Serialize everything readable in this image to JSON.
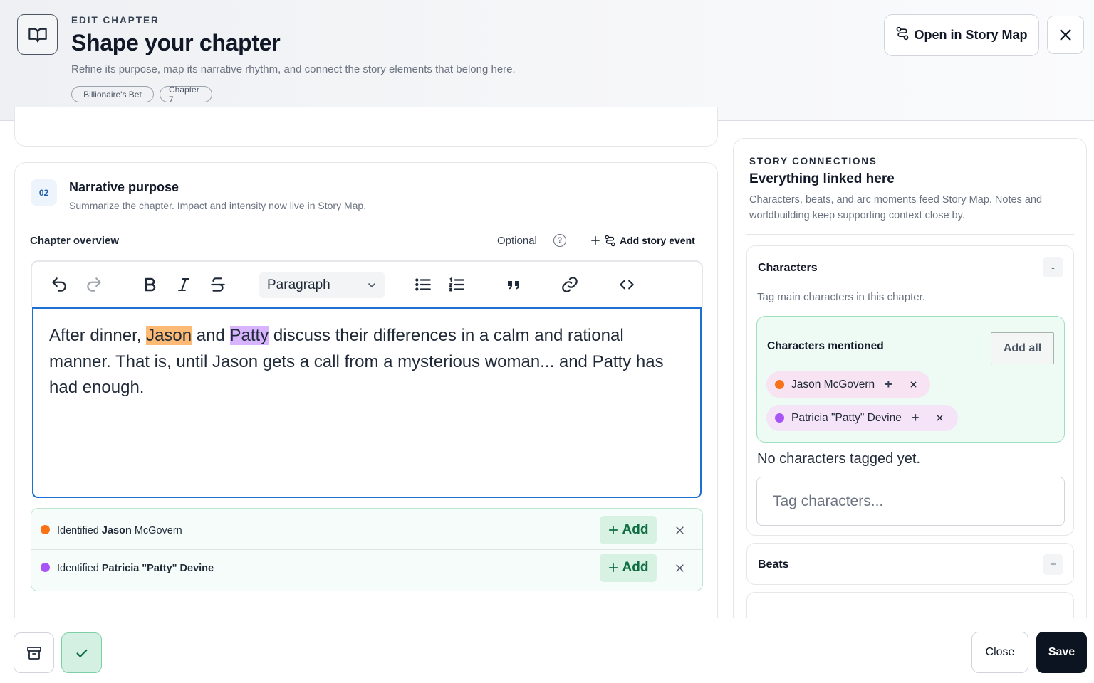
{
  "header": {
    "eyebrow": "EDIT CHAPTER",
    "title": "Shape your chapter",
    "subtitle": "Refine its purpose, map its narrative rhythm, and connect the story elements that belong here.",
    "chips": [
      "Billionaire's Bet",
      "Chapter 7"
    ],
    "open_map_label": "Open in Story Map",
    "icons": {
      "book": "book-open-icon",
      "map": "story-map-icon",
      "close": "close-icon"
    }
  },
  "section": {
    "step": "02",
    "title": "Narrative purpose",
    "description": "Summarize the chapter. Impact and intensity now live in Story Map.",
    "overview_label": "Chapter overview",
    "optional_label": "Optional",
    "help_glyph": "?",
    "add_event_label": "Add story event"
  },
  "toolbar": {
    "block_type": "Paragraph",
    "buttons": [
      "undo-icon",
      "redo-icon",
      "bold-icon",
      "italic-icon",
      "strikethrough-icon",
      "bullet-list-icon",
      "numbered-list-icon",
      "quote-icon",
      "link-icon",
      "code-icon"
    ]
  },
  "editor": {
    "seg1": "After dinner, ",
    "hl1": "Jason",
    "seg2": " and ",
    "hl2": "Patty",
    "seg3": " discuss their differences in a calm and rational manner. That is, until Jason gets a call from a mysterious woman... and Patty has had enough."
  },
  "identified": [
    {
      "prefix": "Identified",
      "bold": "Jason",
      "rest": " McGovern",
      "color": "#f97316",
      "add_label": "Add"
    },
    {
      "prefix": "Identified",
      "bold": "Patricia \"Patty\" Devine",
      "rest": "",
      "color": "#a855f7",
      "add_label": "Add"
    }
  ],
  "sidebar": {
    "eyebrow": "STORY CONNECTIONS",
    "title": "Everything linked here",
    "description": "Characters, beats, and arc moments feed Story Map. Notes and worldbuilding keep supporting context close by.",
    "characters": {
      "title": "Characters",
      "collapse_glyph": "-",
      "description": "Tag main characters in this chapter.",
      "mentioned_title": "Characters mentioned",
      "add_all_label": "Add all",
      "pills": [
        {
          "name": "Jason McGovern",
          "color": "#f97316",
          "plus": "+"
        },
        {
          "name": "Patricia \"Patty\" Devine",
          "color": "#a855f7",
          "plus": "+"
        }
      ],
      "empty_text": "No characters tagged yet.",
      "tag_placeholder": "Tag characters..."
    },
    "beats": {
      "title": "Beats",
      "expand_glyph": "+"
    }
  },
  "footer": {
    "close_label": "Close",
    "save_label": "Save",
    "icons": {
      "archive": "archive-icon",
      "check": "check-icon"
    }
  },
  "colors": {
    "accent_blue": "#1d6fd1",
    "success_green": "#0f6e43",
    "jason_orange": "#f97316",
    "patty_purple": "#a855f7",
    "save_bg": "#0b1420"
  }
}
